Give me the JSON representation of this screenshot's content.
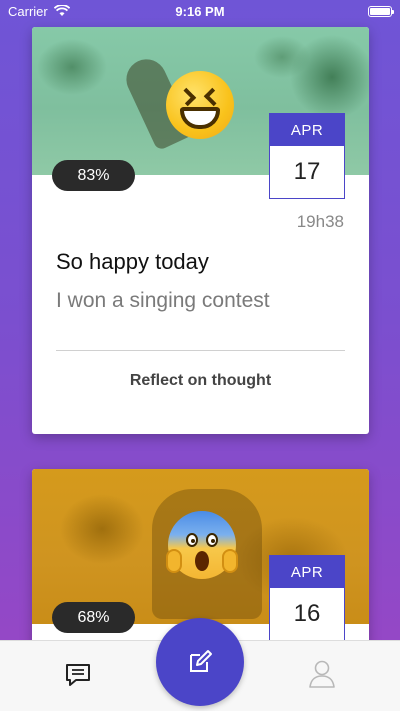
{
  "status_bar": {
    "carrier": "Carrier",
    "time": "9:16 PM"
  },
  "cards": [
    {
      "percent": "83%",
      "emoji": "grinning-squinting-face-icon",
      "date_month": "APR",
      "date_day": "17",
      "time": "19h38",
      "title": "So happy today",
      "subtitle": "I won a singing contest",
      "action_label": "Reflect on thought"
    },
    {
      "percent": "68%",
      "emoji": "screaming-face-icon",
      "date_month": "APR",
      "date_day": "16"
    }
  ],
  "tab_bar": {
    "left_icon": "chat-icon",
    "center_icon": "edit-icon",
    "right_icon": "profile-icon"
  },
  "colors": {
    "accent": "#4b45c8",
    "background_top": "#6f55d6",
    "background_bottom": "#9a46c4",
    "pill": "#2a2a2a"
  }
}
